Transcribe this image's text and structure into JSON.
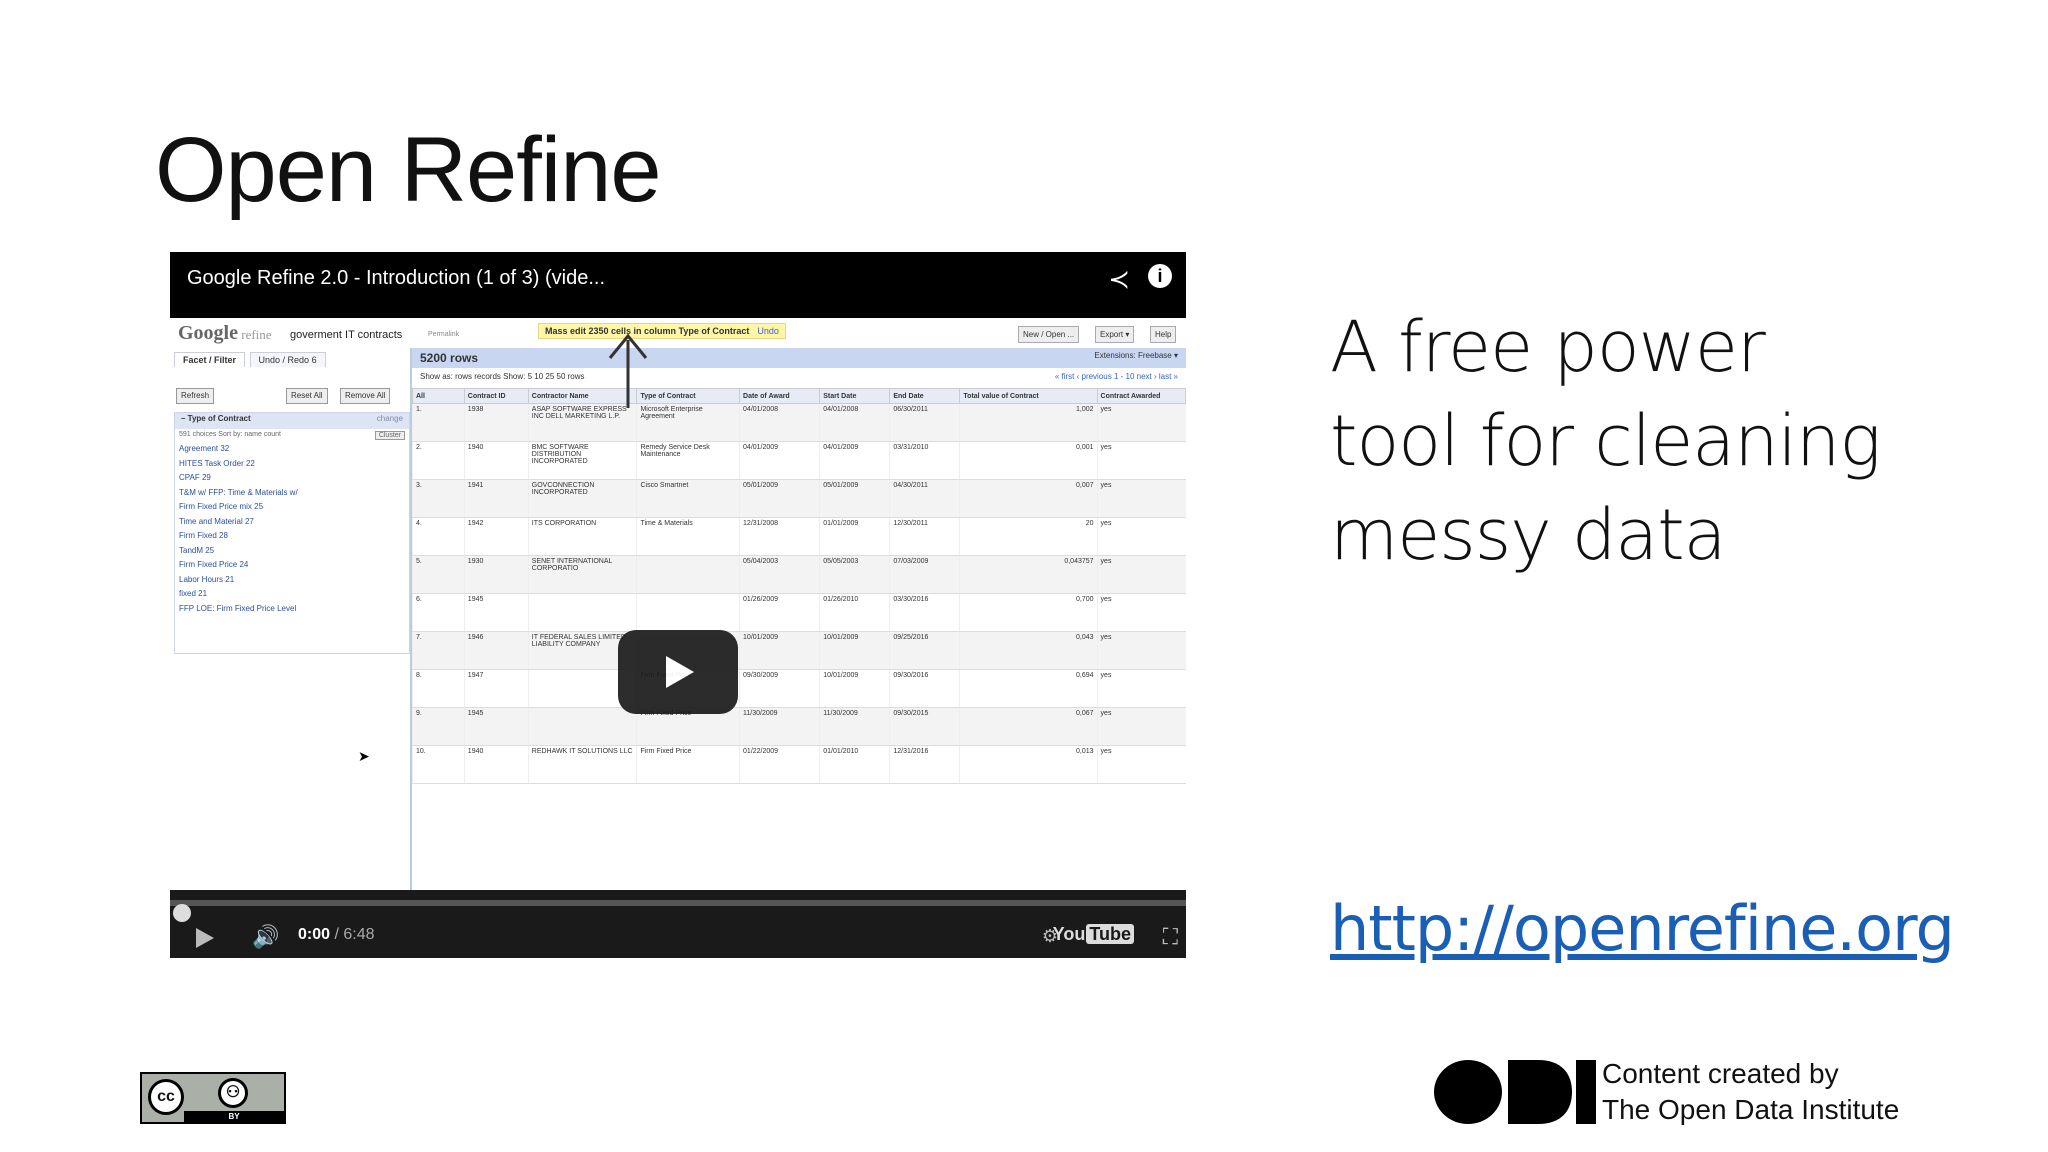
{
  "slide": {
    "title": "Open Refine",
    "tagline": [
      "A free power",
      "tool for cleaning",
      "messy data"
    ],
    "link": "http://openrefine.org",
    "credit": [
      "Content created by",
      "The Open Data Institute"
    ],
    "license": "BY"
  },
  "video": {
    "title": "Google Refine 2.0 - Introduction (1 of 3) (vide...",
    "time_current": "0:00",
    "time_total": " / 6:48",
    "progress": 0.0,
    "youtube_label": "You",
    "youtube_tube": "Tube",
    "screen": {
      "logo": "Google",
      "logo_sub": " refine",
      "project": "goverment IT contracts",
      "permalink": "Permalink",
      "notice": "Mass edit 2350 cells in column Type of Contract",
      "notice_undo": "Undo",
      "buttons": [
        "New / Open ...",
        "Export ▾",
        "Help"
      ],
      "extensions": "Extensions:  Freebase ▾",
      "tabs": [
        "Facet / Filter",
        "Undo / Redo 6"
      ],
      "refresh": "Refresh",
      "reset_all": "Reset All",
      "remove_all": "Remove All",
      "facet_title": "– Type of Contract",
      "facet_change": "change",
      "facet_sub": "591 choices  Sort by: name  count",
      "facet_cluster": "Cluster",
      "facet_items": [
        "Agreement 32",
        "HITES Task Order 22",
        "CPAF 29",
        "T&M w/ FFP: Time & Materials w/",
        "Firm Fixed Price mix 25",
        "Time and Material 27",
        "Firm Fixed 28",
        "TandM 25",
        "Firm Fixed Price 24",
        "Labor Hours 21",
        "fixed 21",
        "FFP LOE: Firm Fixed Price Level"
      ],
      "rows_label": "5200 rows",
      "showas": "Show as:  rows  records        Show: 5  10  25  50  rows",
      "pager": "« first  ‹ previous  1 - 10  next ›  last »",
      "columns": [
        "All",
        "Contract ID",
        "Contractor Name",
        "Type of Contract",
        "Date of Award",
        "Start Date",
        "End Date",
        "Total value of Contract",
        "Contract Awarded"
      ],
      "rows": [
        [
          "1.",
          "1938",
          "ASAP SOFTWARE EXPRESS INC DELL MARKETING L.P.",
          "Microsoft Enterprise Agreement",
          "04/01/2008",
          "04/01/2008",
          "06/30/2011",
          "1,002",
          "yes"
        ],
        [
          "2.",
          "1940",
          "BMC SOFTWARE DISTRIBUTION INCORPORATED",
          "Remedy Service Desk Maintenance",
          "04/01/2009",
          "04/01/2009",
          "03/31/2010",
          "0,001",
          "yes"
        ],
        [
          "3.",
          "1941",
          "GOVCONNECTION INCORPORATED",
          "Cisco Smartnet",
          "05/01/2009",
          "05/01/2009",
          "04/30/2011",
          "0,007",
          "yes"
        ],
        [
          "4.",
          "1942",
          "ITS CORPORATION",
          "Time & Materials",
          "12/31/2008",
          "01/01/2009",
          "12/30/2011",
          "20",
          "yes"
        ],
        [
          "5.",
          "1930",
          "SENET INTERNATIONAL CORPORATIO",
          "",
          "05/04/2003",
          "05/05/2003",
          "07/03/2009",
          "0,043757",
          "yes"
        ],
        [
          "6.",
          "1945",
          "",
          "",
          "01/26/2009",
          "01/26/2010",
          "03/30/2016",
          "0,700",
          "yes"
        ],
        [
          "7.",
          "1946",
          "IT FEDERAL SALES LIMITED LIABILITY COMPANY",
          "",
          "10/01/2009",
          "10/01/2009",
          "09/25/2016",
          "0,043",
          "yes"
        ],
        [
          "8.",
          "1947",
          "",
          "Firm Fixed Price",
          "09/30/2009",
          "10/01/2009",
          "09/30/2016",
          "0,694",
          "yes"
        ],
        [
          "9.",
          "1945",
          "",
          "Firm Fixed Price",
          "11/30/2009",
          "11/30/2009",
          "09/30/2015",
          "0,067",
          "yes"
        ],
        [
          "10.",
          "1940",
          "REDHAWK IT SOLUTIONS LLC",
          "Firm Fixed Price",
          "01/22/2009",
          "01/01/2010",
          "12/31/2016",
          "0,013",
          "yes"
        ]
      ]
    }
  }
}
